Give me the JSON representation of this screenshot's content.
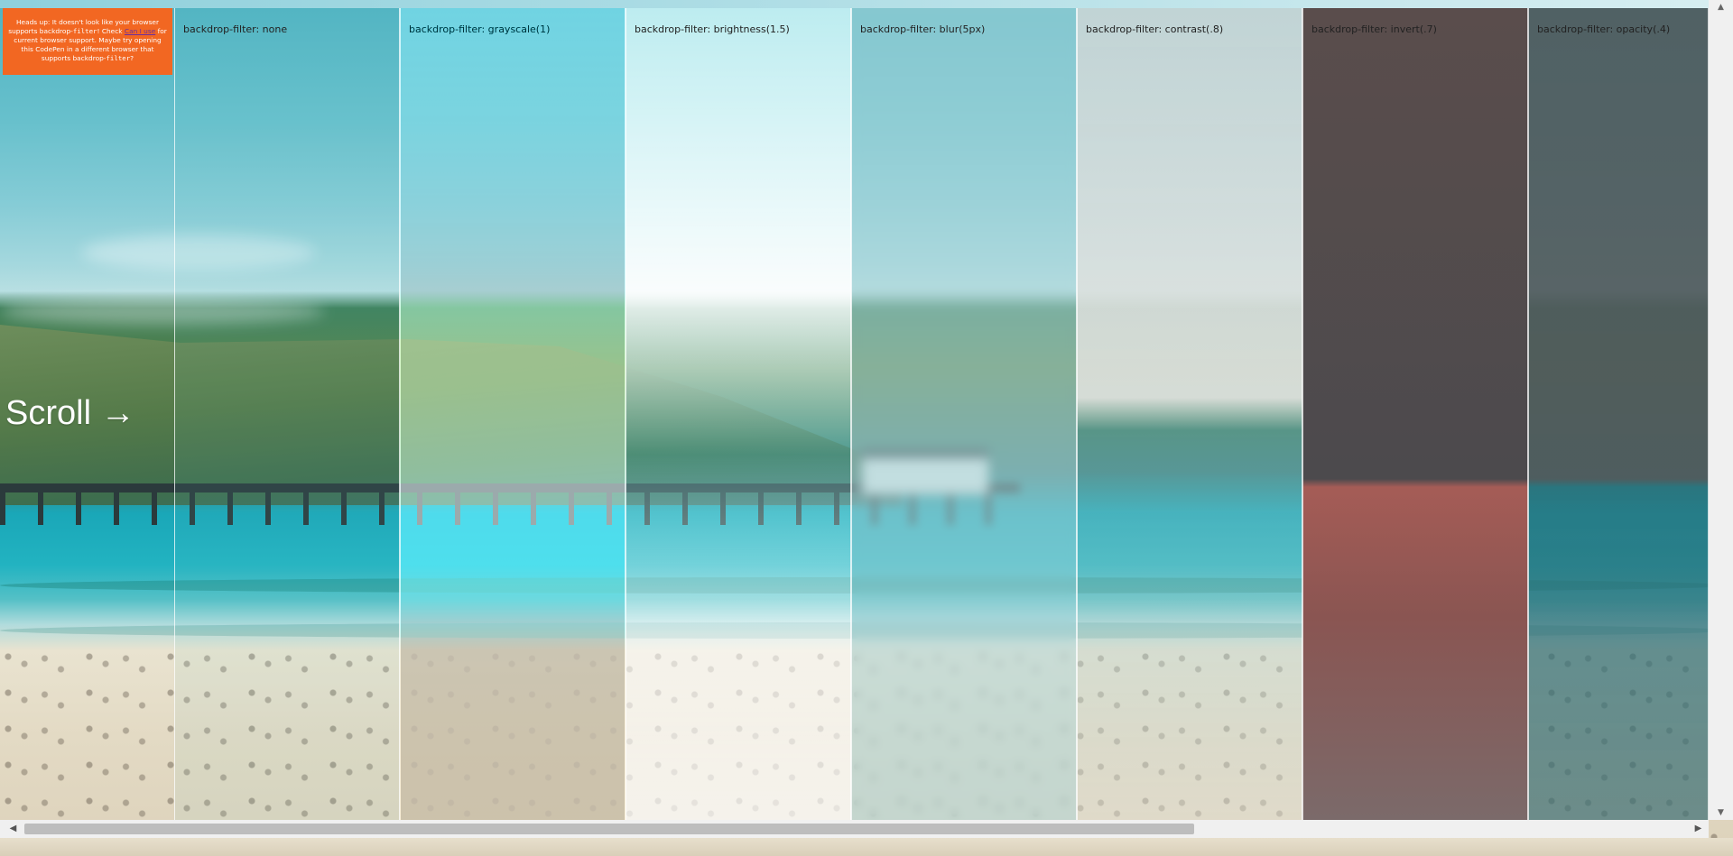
{
  "warning": {
    "text_before": "Heads up: It doesn't look like your browser supports backdrop-",
    "code1": "filter",
    "text_mid": "! Check ",
    "link": "Can I use",
    "text_after": " for current browser support. Maybe try opening this CodePen in a different browser that supports backdrop-",
    "code2": "filter",
    "text_end": "?"
  },
  "scroll_label": "Scroll →",
  "panels": [
    {
      "label": "backdrop-filter: none"
    },
    {
      "label": "backdrop-filter: grayscale(1)"
    },
    {
      "label": "backdrop-filter: brightness(1.5)"
    },
    {
      "label": "backdrop-filter: blur(5px)"
    },
    {
      "label": "backdrop-filter: contrast(.8)"
    },
    {
      "label": "backdrop-filter: invert(.7)"
    },
    {
      "label": "backdrop-filter: opacity(.4)"
    }
  ],
  "scrollbar": {
    "left_arrow": "◀",
    "right_arrow": "▶",
    "up_arrow": "▲",
    "down_arrow": "▼"
  }
}
